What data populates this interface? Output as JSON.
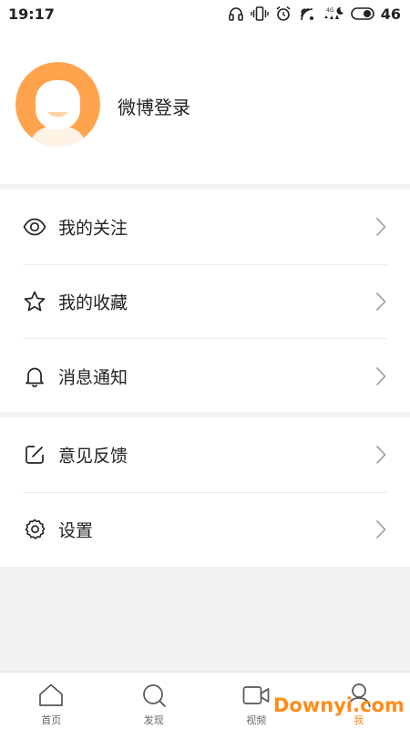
{
  "status_bar": {
    "time": "19:17",
    "battery": "46"
  },
  "profile": {
    "login_label": "微博登录"
  },
  "menu_section_1": {
    "items": [
      {
        "label": "我的关注",
        "icon": "eye-icon"
      },
      {
        "label": "我的收藏",
        "icon": "star-icon"
      },
      {
        "label": "消息通知",
        "icon": "bell-icon"
      }
    ]
  },
  "menu_section_2": {
    "items": [
      {
        "label": "意见反馈",
        "icon": "edit-icon"
      },
      {
        "label": "设置",
        "icon": "gear-icon"
      }
    ]
  },
  "tab_bar": {
    "tabs": [
      {
        "label": "首页",
        "icon": "home-icon"
      },
      {
        "label": "发现",
        "icon": "search-icon"
      },
      {
        "label": "视频",
        "icon": "video-icon"
      },
      {
        "label": "我",
        "icon": "user-icon",
        "active": true
      }
    ]
  },
  "watermark": "Downyi.com",
  "colors": {
    "accent": "#ff8c1a",
    "avatar": "#ffa34d",
    "background": "#f2f2f2"
  }
}
